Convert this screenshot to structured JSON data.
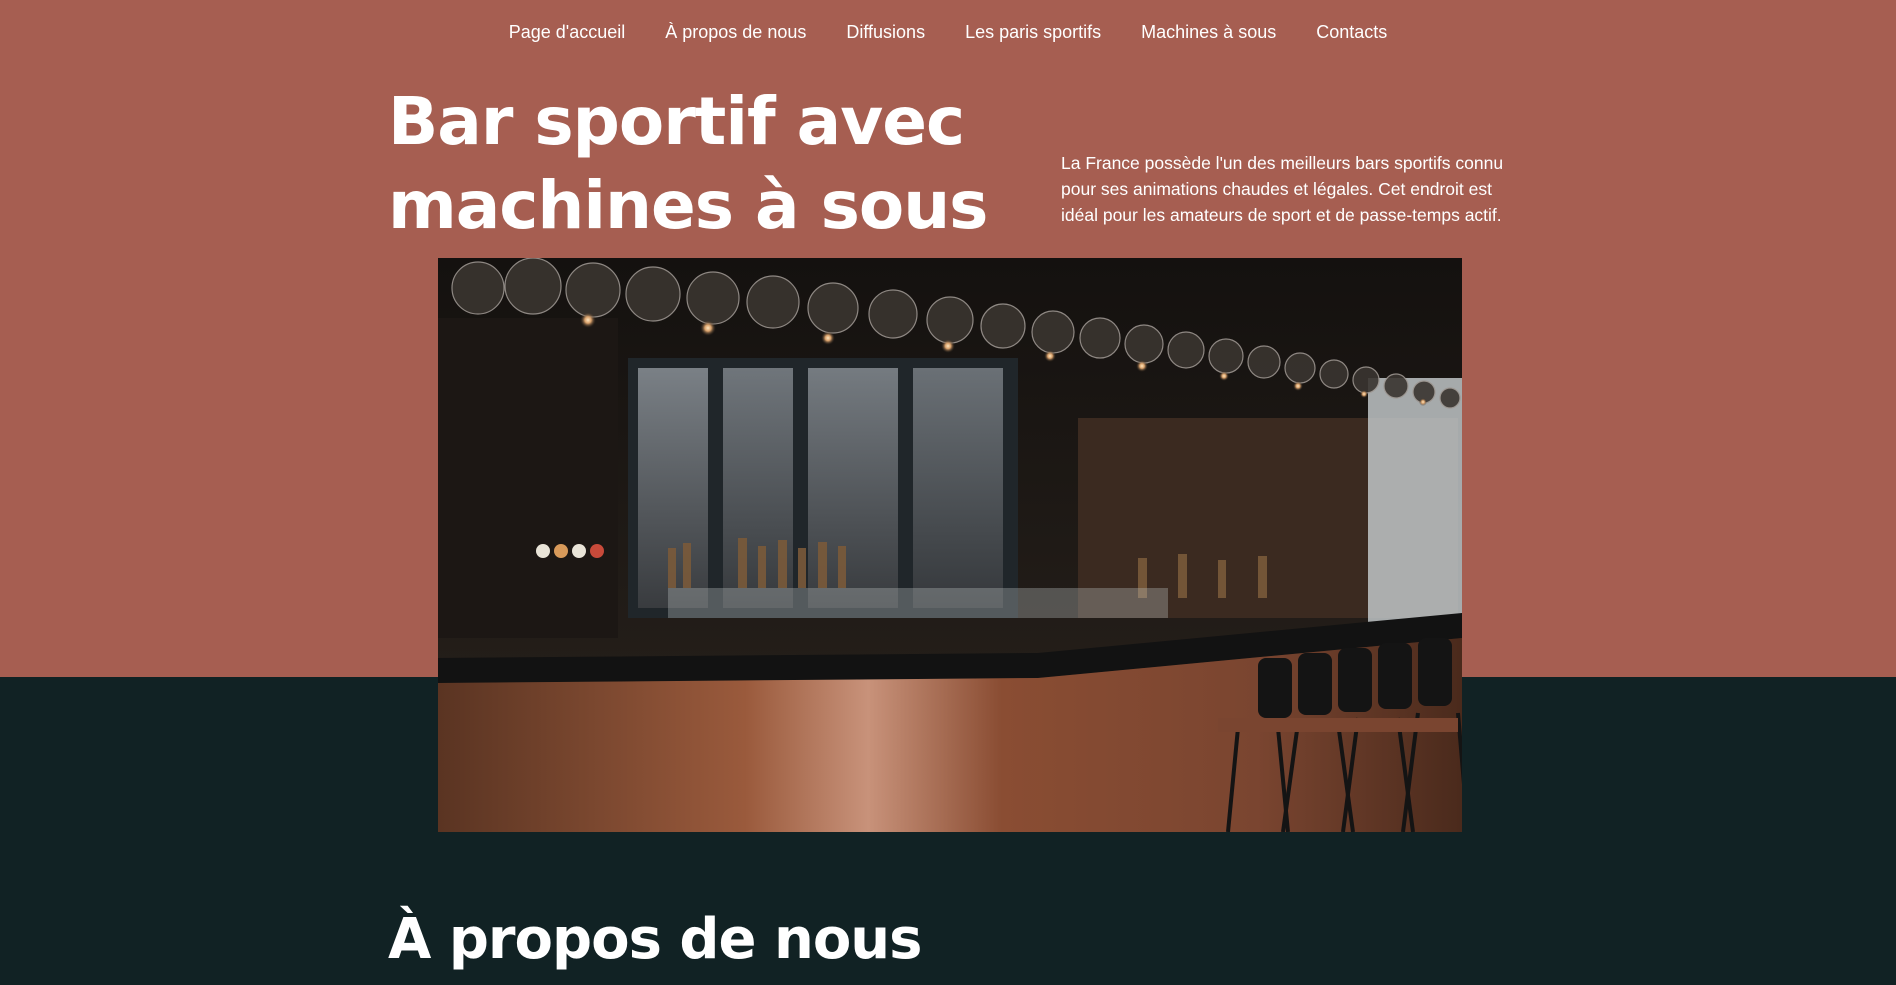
{
  "nav": {
    "items": [
      {
        "label": "Page d'accueil"
      },
      {
        "label": "À propos de nous"
      },
      {
        "label": "Diffusions"
      },
      {
        "label": "Les paris sportifs"
      },
      {
        "label": "Machines à sous"
      },
      {
        "label": "Contacts"
      }
    ]
  },
  "hero": {
    "title_line1": "Bar sportif avec",
    "title_line2": "machines à sous",
    "description": "La France possède l'un des meilleurs bars sportifs connu pour ses animations chaudes et légales. Cet endroit est idéal pour les amateurs de sport et de passe-temps actif.",
    "image_icon": "bar-interior-photo"
  },
  "about": {
    "title": "À propos de nous"
  },
  "colors": {
    "top_band": "#a65e51",
    "bottom_band": "#112224",
    "text": "#ffffff"
  }
}
